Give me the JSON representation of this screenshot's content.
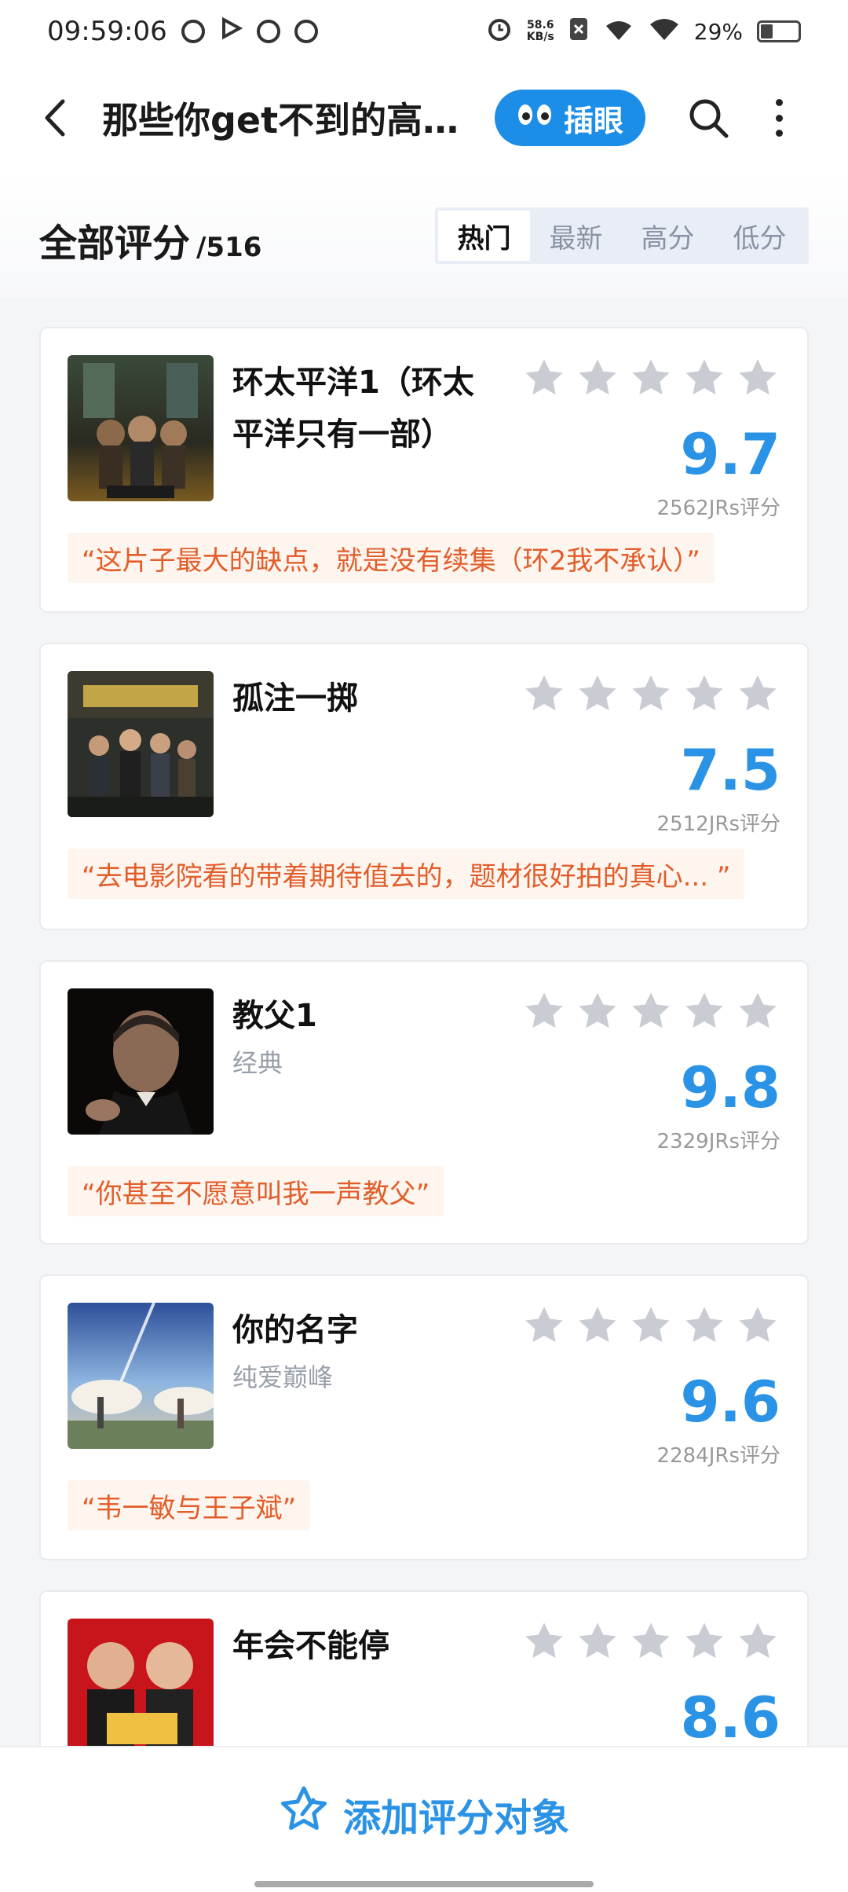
{
  "statusbar": {
    "time": "09:59:06",
    "netspeed_value": "58.6",
    "netspeed_unit": "KB/s",
    "battery": "29%"
  },
  "topbar": {
    "title": "那些你get不到的高...",
    "peek_label": "插眼",
    "back_icon": "back-arrow-icon",
    "search_icon": "search-icon",
    "more_icon": "more-vertical-icon"
  },
  "section": {
    "title": "全部评分",
    "count": "/516",
    "tabs": [
      "热门",
      "最新",
      "高分",
      "低分"
    ],
    "active_tab": "热门"
  },
  "items": [
    {
      "name": "环太平洋1（环太平洋只有一部）",
      "subtitle": "",
      "score": "9.7",
      "votes": "2562JRs评分",
      "quote": "“这片子最大的缺点，就是没有续集（环2我不承认）”"
    },
    {
      "name": "孤注一掷",
      "subtitle": "",
      "score": "7.5",
      "votes": "2512JRs评分",
      "quote": "“去电影院看的带着期待值去的，题材很好拍的真心... ”"
    },
    {
      "name": "教父1",
      "subtitle": "经典",
      "score": "9.8",
      "votes": "2329JRs评分",
      "quote": "“你甚至不愿意叫我一声教父”"
    },
    {
      "name": "你的名字",
      "subtitle": "纯爱巅峰",
      "score": "9.6",
      "votes": "2284JRs评分",
      "quote": "“韦一敏与王子斌”"
    },
    {
      "name": "年会不能停",
      "subtitle": "",
      "score": "8.6",
      "votes": "",
      "quote": ""
    }
  ],
  "bottom": {
    "add_label": "添加评分对象"
  },
  "colors": {
    "accent": "#2b93e6",
    "quote_text": "#e25d2a",
    "quote_bg": "#fef5ee",
    "star_gray": "#c9ccd3"
  }
}
